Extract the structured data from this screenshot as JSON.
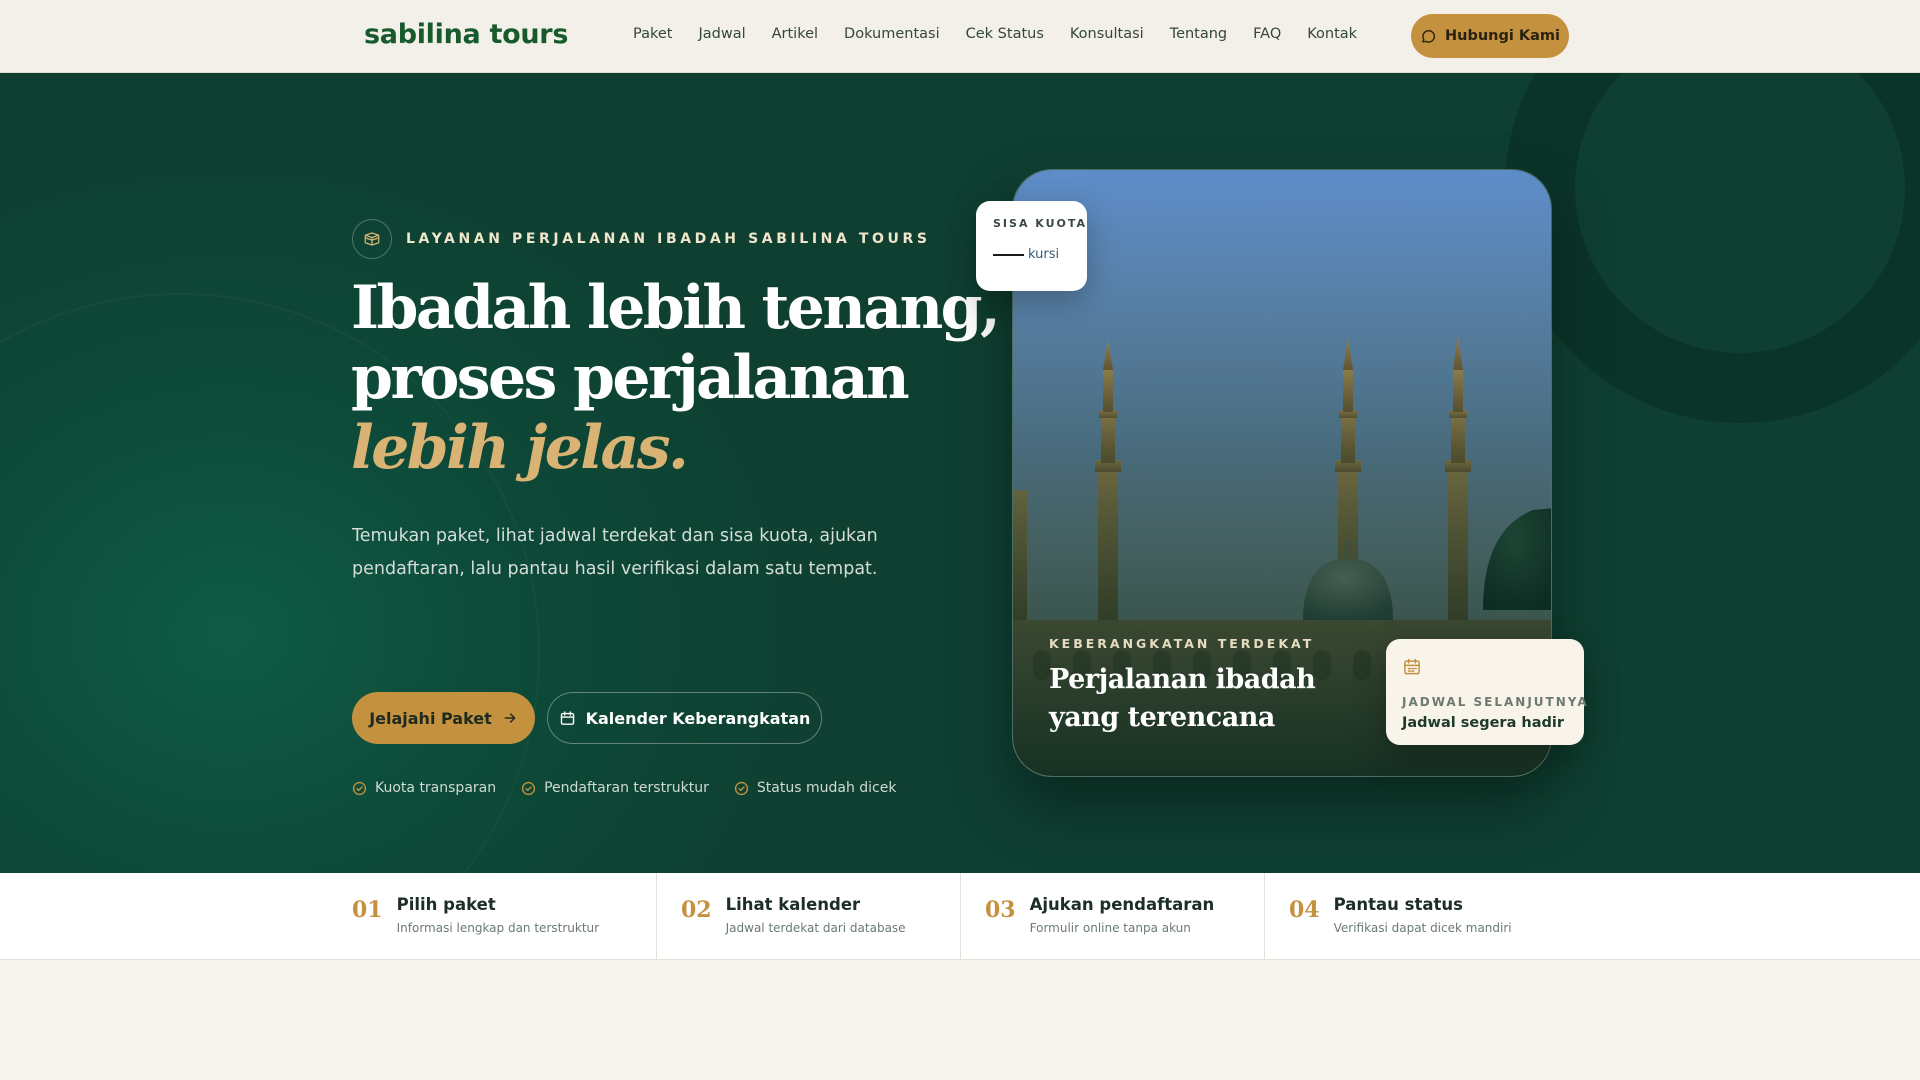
{
  "brand": {
    "logo_text": "sabilina tours"
  },
  "nav": {
    "items": [
      "Paket",
      "Jadwal",
      "Artikel",
      "Dokumentasi",
      "Cek Status",
      "Konsultasi",
      "Tentang",
      "FAQ",
      "Kontak"
    ],
    "cta_label": "Hubungi Kami"
  },
  "hero": {
    "eyebrow": "LAYANAN PERJALANAN IBADAH SABILINA TOURS",
    "headline_line1": "Ibadah lebih tenang,",
    "headline_line2": "proses perjalanan",
    "headline_line3": "lebih jelas.",
    "lead": "Temukan paket, lihat jadwal terdekat dan sisa kuota, ajukan pendaftaran, lalu pantau hasil verifikasi dalam satu tempat.",
    "primary_button": "Jelajahi Paket",
    "secondary_button": "Kalender Keberangkatan",
    "checks": [
      "Kuota transparan",
      "Pendaftaran terstruktur",
      "Status mudah dicek"
    ]
  },
  "card": {
    "quota_label": "SISA KUOTA",
    "quota_unit": "kursi",
    "caption_kicker": "KEBERANGKATAN TERDEKAT",
    "caption_title": "Perjalanan ibadah yang terencana",
    "schedule_label": "JADWAL SELANJUTNYA",
    "schedule_value": "Jadwal segera hadir"
  },
  "steps": [
    {
      "num": "01",
      "title": "Pilih paket",
      "sub": "Informasi lengkap dan terstruktur"
    },
    {
      "num": "02",
      "title": "Lihat kalender",
      "sub": "Jadwal terdekat dari database"
    },
    {
      "num": "03",
      "title": "Ajukan pendaftaran",
      "sub": "Formulir online tanpa akun"
    },
    {
      "num": "04",
      "title": "Pantau status",
      "sub": "Verifikasi dapat dicek mandiri"
    }
  ],
  "colors": {
    "brand_green": "#175a2c",
    "hero_bg": "#0f4a3a",
    "accent_gold": "#c4913f",
    "headline_gold": "#d9b374"
  },
  "icons": [
    "chat-icon",
    "kaaba-icon",
    "arrow-right-icon",
    "calendar-icon",
    "check-circle-icon"
  ]
}
